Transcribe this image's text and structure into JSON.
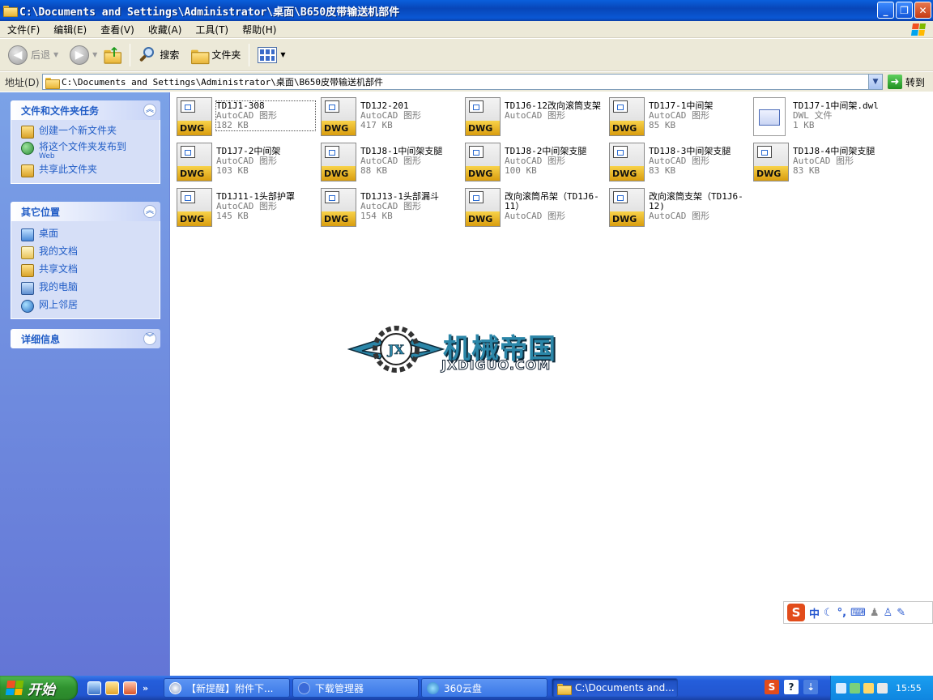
{
  "window": {
    "title": "C:\\Documents and Settings\\Administrator\\桌面\\B650皮带输送机部件",
    "controls": {
      "minimize": "_",
      "maximize": "❐",
      "close": "✕"
    }
  },
  "menu": [
    "文件(F)",
    "编辑(E)",
    "查看(V)",
    "收藏(A)",
    "工具(T)",
    "帮助(H)"
  ],
  "toolbar": {
    "back_label": "后退",
    "search_label": "搜索",
    "folders_label": "文件夹"
  },
  "address": {
    "label": "地址(D)",
    "value": "C:\\Documents and Settings\\Administrator\\桌面\\B650皮带输送机部件",
    "go_label": "转到"
  },
  "tasks_panel": {
    "title": "文件和文件夹任务",
    "items": [
      {
        "label": "创建一个新文件夹",
        "sub": "",
        "icon": "new-folder-icon"
      },
      {
        "label": "将这个文件夹发布到",
        "sub": "Web",
        "icon": "globe-icon"
      },
      {
        "label": "共享此文件夹",
        "sub": "",
        "icon": "share-icon"
      }
    ]
  },
  "places_panel": {
    "title": "其它位置",
    "items": [
      {
        "label": "桌面",
        "icon": "desktop-icon"
      },
      {
        "label": "我的文档",
        "icon": "my-documents-icon"
      },
      {
        "label": "共享文档",
        "icon": "shared-documents-icon"
      },
      {
        "label": "我的电脑",
        "icon": "my-computer-icon"
      },
      {
        "label": "网上邻居",
        "icon": "network-places-icon"
      }
    ]
  },
  "details_panel": {
    "title": "详细信息"
  },
  "files": [
    {
      "name": "TD1J1-308",
      "type": "AutoCAD 图形",
      "size": "182 KB",
      "icon": "dwg",
      "selected": true
    },
    {
      "name": "TD1J2-201",
      "type": "AutoCAD 图形",
      "size": "417 KB",
      "icon": "dwg"
    },
    {
      "name": "TD1J6-12改向滚筒支架",
      "type": "AutoCAD 图形",
      "size": "",
      "icon": "dwg"
    },
    {
      "name": "TD1J7-1中间架",
      "type": "AutoCAD 图形",
      "size": "85 KB",
      "icon": "dwg"
    },
    {
      "name": "TD1J7-1中间架.dwl",
      "type": "DWL 文件",
      "size": "1 KB",
      "icon": "dwl"
    },
    {
      "name": "TD1J7-2中间架",
      "type": "AutoCAD 图形",
      "size": "103 KB",
      "icon": "dwg"
    },
    {
      "name": "TD1J8-1中间架支腿",
      "type": "AutoCAD 图形",
      "size": "88 KB",
      "icon": "dwg"
    },
    {
      "name": "TD1J8-2中间架支腿",
      "type": "AutoCAD 图形",
      "size": "100 KB",
      "icon": "dwg"
    },
    {
      "name": "TD1J8-3中间架支腿",
      "type": "AutoCAD 图形",
      "size": "83 KB",
      "icon": "dwg"
    },
    {
      "name": "TD1J8-4中间架支腿",
      "type": "AutoCAD 图形",
      "size": "83 KB",
      "icon": "dwg"
    },
    {
      "name": "TD1J11-1头部护罩",
      "type": "AutoCAD 图形",
      "size": "145 KB",
      "icon": "dwg"
    },
    {
      "name": "TD1J13-1头部漏斗",
      "type": "AutoCAD 图形",
      "size": "154 KB",
      "icon": "dwg"
    },
    {
      "name": "改向滚筒吊架（TD1J6-11）",
      "type": "AutoCAD 图形",
      "size": "",
      "icon": "dwg"
    },
    {
      "name": "改向滚筒支架（TD1J6-12)",
      "type": "AutoCAD 图形",
      "size": "",
      "icon": "dwg"
    }
  ],
  "dwg_tag": "DWG",
  "watermark": {
    "text": "机械帝国",
    "url": "JXDIGUO.COM",
    "badge": "JX"
  },
  "ime": {
    "logo": "S",
    "mode": "中"
  },
  "taskbar": {
    "start_label": "开始",
    "buttons": [
      {
        "label": "【新提醒】附件下..."
      },
      {
        "label": "下载管理器"
      },
      {
        "label": "360云盘"
      },
      {
        "label": "C:\\Documents and..."
      }
    ],
    "clock": "15:55"
  },
  "colors": {
    "accent": "#215dc6",
    "titlebar": "#0a57d4",
    "taskpane": "#6375d6",
    "dwg_tag": "#f2c230"
  }
}
